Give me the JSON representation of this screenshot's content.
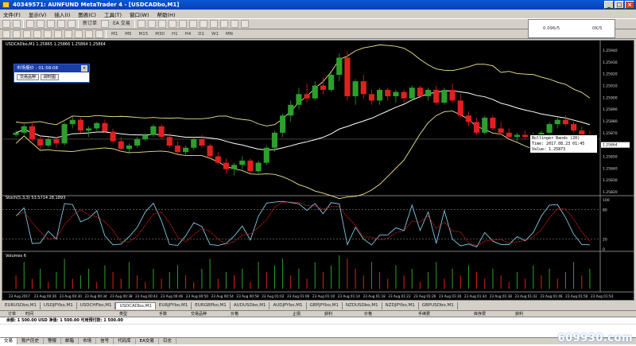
{
  "window": {
    "title": "40349571: AUNFUND MetaTrader 4 - [USDCADbo,M1]"
  },
  "menu": [
    "文件(F)",
    "显示(V)",
    "插入(I)",
    "图表(C)",
    "工具(T)",
    "窗口(W)",
    "帮助(H)"
  ],
  "toolbar": {
    "new_order": "新订单",
    "expert": "EA 交易",
    "timeframes": [
      "M1",
      "M5",
      "M15",
      "M30",
      "H1",
      "H4",
      "D1",
      "W1",
      "MN"
    ]
  },
  "mini_chart": {
    "left": "0.096/5",
    "right": "0K/5"
  },
  "chart": {
    "symbol_label": "USDCADbo,M1  1.25865 1.25866 1.25864 1.25864",
    "stoch_label": "Stoch(5,3,3) 53.5714 28.1893",
    "volume_label": "Volumes 6",
    "price_axis": [
      "1.25940",
      "1.25930",
      "1.25920",
      "1.25910",
      "1.25900",
      "1.25890",
      "1.25880",
      "1.25870",
      "1.25864",
      "1.25850",
      "1.25840",
      "1.25830",
      "1.25820"
    ],
    "stoch_axis": [
      "100",
      "80",
      "20",
      "0"
    ],
    "time_axis": [
      "23 Aug 2017",
      "23 Aug 00:26",
      "23 Aug 00:30",
      "23 Aug 00:34",
      "23 Aug 00:38",
      "23 Aug 00:42",
      "23 Aug 00:46",
      "23 Aug 00:50",
      "23 Aug 00:54",
      "23 Aug 00:58",
      "23 Aug 01:02",
      "23 Aug 01:06",
      "23 Aug 01:10",
      "23 Aug 01:14",
      "23 Aug 01:18",
      "23 Aug 01:22",
      "23 Aug 01:26",
      "23 Aug 01:30",
      "23 Aug 01:34",
      "23 Aug 01:38",
      "23 Aug 01:42",
      "23 Aug 01:46",
      "23 Aug 01:50",
      "23 Aug 01:54"
    ],
    "candles": [
      [
        1.25868,
        1.25872,
        1.25866,
        1.2587
      ],
      [
        1.2587,
        1.25878,
        1.25868,
        1.25876
      ],
      [
        1.25876,
        1.2588,
        1.25862,
        1.25864
      ],
      [
        1.25864,
        1.25868,
        1.25855,
        1.25858
      ],
      [
        1.25858,
        1.25866,
        1.25856,
        1.25864
      ],
      [
        1.25864,
        1.25866,
        1.25856,
        1.2586
      ],
      [
        1.2586,
        1.2588,
        1.25858,
        1.25878
      ],
      [
        1.25878,
        1.25885,
        1.25874,
        1.25882
      ],
      [
        1.25882,
        1.25884,
        1.2587,
        1.25872
      ],
      [
        1.25872,
        1.25876,
        1.25866,
        1.25874
      ],
      [
        1.25874,
        1.2588,
        1.25872,
        1.25879
      ],
      [
        1.25879,
        1.25882,
        1.2587,
        1.25871
      ],
      [
        1.25871,
        1.25874,
        1.2586,
        1.25862
      ],
      [
        1.25862,
        1.25866,
        1.25852,
        1.25855
      ],
      [
        1.25855,
        1.2586,
        1.2585,
        1.25858
      ],
      [
        1.25858,
        1.25866,
        1.25856,
        1.25864
      ],
      [
        1.25864,
        1.2587,
        1.25862,
        1.25868
      ],
      [
        1.25868,
        1.25878,
        1.25866,
        1.25876
      ],
      [
        1.25876,
        1.25878,
        1.25864,
        1.25866
      ],
      [
        1.25866,
        1.2587,
        1.25856,
        1.25858
      ],
      [
        1.25858,
        1.25862,
        1.2585,
        1.25852
      ],
      [
        1.25852,
        1.25858,
        1.25848,
        1.25856
      ],
      [
        1.25856,
        1.25866,
        1.25854,
        1.25864
      ],
      [
        1.25864,
        1.25868,
        1.25856,
        1.25858
      ],
      [
        1.25858,
        1.2586,
        1.25846,
        1.25848
      ],
      [
        1.25848,
        1.25852,
        1.2584,
        1.25842
      ],
      [
        1.25842,
        1.25846,
        1.25832,
        1.25836
      ],
      [
        1.25836,
        1.25842,
        1.2583,
        1.2584
      ],
      [
        1.2584,
        1.25848,
        1.25836,
        1.25844
      ],
      [
        1.25844,
        1.25846,
        1.25832,
        1.25834
      ],
      [
        1.25834,
        1.25844,
        1.25832,
        1.25842
      ],
      [
        1.25842,
        1.25858,
        1.2584,
        1.25856
      ],
      [
        1.25856,
        1.25872,
        1.25852,
        1.2587
      ],
      [
        1.2587,
        1.25888,
        1.25866,
        1.25886
      ],
      [
        1.25886,
        1.259,
        1.2588,
        1.25896
      ],
      [
        1.25896,
        1.25912,
        1.25892,
        1.25906
      ],
      [
        1.25906,
        1.25916,
        1.25898,
        1.25902
      ],
      [
        1.25902,
        1.25918,
        1.259,
        1.25914
      ],
      [
        1.25914,
        1.25922,
        1.25906,
        1.2591
      ],
      [
        1.2591,
        1.25926,
        1.25908,
        1.25924
      ],
      [
        1.25924,
        1.25944,
        1.25918,
        1.2594
      ],
      [
        1.2594,
        1.25946,
        1.259,
        1.25904
      ],
      [
        1.25904,
        1.2592,
        1.25896,
        1.25918
      ],
      [
        1.25918,
        1.25924,
        1.25902,
        1.25906
      ],
      [
        1.25906,
        1.2591,
        1.25896,
        1.259
      ],
      [
        1.259,
        1.25912,
        1.25896,
        1.2591
      ],
      [
        1.2591,
        1.25912,
        1.259,
        1.25904
      ],
      [
        1.25904,
        1.2591,
        1.25898,
        1.25908
      ],
      [
        1.25908,
        1.2591,
        1.25898,
        1.25902
      ],
      [
        1.25902,
        1.25914,
        1.259,
        1.25912
      ],
      [
        1.25912,
        1.25914,
        1.25902,
        1.25904
      ],
      [
        1.25904,
        1.25912,
        1.259,
        1.2591
      ],
      [
        1.2591,
        1.25914,
        1.25896,
        1.25898
      ],
      [
        1.25898,
        1.25912,
        1.25896,
        1.2591
      ],
      [
        1.2591,
        1.25916,
        1.25898,
        1.259
      ],
      [
        1.259,
        1.25906,
        1.25884,
        1.25886
      ],
      [
        1.25886,
        1.2589,
        1.25876,
        1.2588
      ],
      [
        1.2588,
        1.25884,
        1.25868,
        1.2587
      ],
      [
        1.2587,
        1.25886,
        1.25868,
        1.25884
      ],
      [
        1.25884,
        1.25886,
        1.25872,
        1.25874
      ],
      [
        1.25874,
        1.2588,
        1.25868,
        1.2587
      ],
      [
        1.2587,
        1.25874,
        1.25864,
        1.25866
      ],
      [
        1.25866,
        1.2587,
        1.25862,
        1.25868
      ],
      [
        1.25868,
        1.25872,
        1.25864,
        1.25866
      ],
      [
        1.25866,
        1.2587,
        1.25864,
        1.25868
      ],
      [
        1.25868,
        1.25872,
        1.25866,
        1.2587
      ],
      [
        1.2587,
        1.2588,
        1.25868,
        1.25878
      ],
      [
        1.25878,
        1.25884,
        1.25874,
        1.25882
      ],
      [
        1.25882,
        1.25886,
        1.25876,
        1.25878
      ],
      [
        1.25878,
        1.2588,
        1.2587,
        1.25872
      ],
      [
        1.25872,
        1.25876,
        1.25864,
        1.25866
      ],
      [
        1.25866,
        1.25872,
        1.25862,
        1.25864
      ]
    ],
    "volumes": [
      4,
      8,
      3,
      6,
      2,
      5,
      9,
      3,
      4,
      6,
      2,
      7,
      5,
      3,
      8,
      4,
      2,
      6,
      3,
      5,
      7,
      4,
      2,
      6,
      9,
      3,
      5,
      4,
      6,
      2,
      8,
      5,
      7,
      9,
      4,
      6,
      3,
      8,
      5,
      7,
      10,
      9,
      6,
      4,
      8,
      5,
      3,
      7,
      4,
      6,
      2,
      5,
      8,
      3,
      6,
      4,
      7,
      5,
      3,
      6,
      4,
      2,
      5,
      3,
      7,
      4,
      6,
      3,
      5,
      8,
      4,
      6
    ],
    "tooltip": {
      "line1": "Bollinger Bands (20)",
      "line2": "Time: 2017.08.23 01:45",
      "line3": "Value: 1.25873"
    }
  },
  "trade_panel": {
    "title": "市场报价 : 01:58:08",
    "tab1": "交易品种",
    "tab2": "即时图"
  },
  "chart_tabs": [
    "EURUSDbo,M1",
    "USDJPYbo,M1",
    "USDCHFbo,M1",
    "USDCADbo,M1",
    "EURJPYbo,M1",
    "EURGBPbo,M1",
    "AUDUSDbo,M1",
    "AUDJPYbo,M1",
    "GBPJPYbo,M1",
    "NZDUSDbo,M1",
    "NZDJPYbo,M1",
    "GBPUSDbo,M1"
  ],
  "active_chart_tab": "USDCADbo,M1",
  "terminal": {
    "columns": [
      "订单",
      "时间",
      "类型",
      "手数",
      "交易品种",
      "价格",
      "止损",
      "获利",
      "价格",
      "手续费",
      "库存费",
      "获利"
    ],
    "balance_row": "余额: 1 500.00 USD   净值: 1 500.00   可用预付款: 1 500.00",
    "tabs": [
      "交易",
      "账户历史",
      "警报",
      "邮箱",
      "市场",
      "信号",
      "代码库",
      "EA交易",
      "日志"
    ]
  },
  "watermark": "609930.com"
}
